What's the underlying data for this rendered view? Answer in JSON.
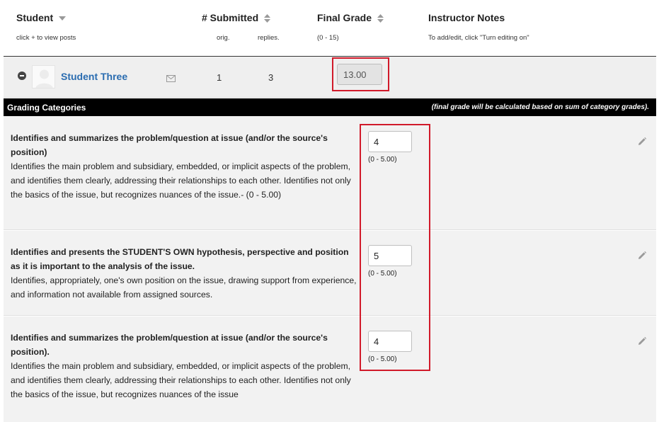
{
  "header": {
    "student": {
      "label": "Student",
      "sub": "click + to view posts"
    },
    "submitted": {
      "label": "# Submitted",
      "orig": "orig.",
      "replies": "replies."
    },
    "final_grade": {
      "label": "Final Grade",
      "sub": "(0 - 15)"
    },
    "notes": {
      "label": "Instructor Notes",
      "sub": "To add/edit, click \"Turn editing on\""
    }
  },
  "student": {
    "name": "Student Three",
    "orig": "1",
    "replies": "3",
    "final_grade": "13.00"
  },
  "band": {
    "title": "Grading Categories",
    "note": "(final grade will be calculated based on sum of category grades)."
  },
  "categories": [
    {
      "title": "Identifies and summarizes the problem/question at issue (and/or the source's position)",
      "desc": "Identifies the main problem and subsidiary, embedded, or implicit aspects of the problem, and identifies them clearly, addressing their relationships to each other. Identifies not only the basics of the issue, but recognizes nuances of the issue.- (0 - 5.00)",
      "score": "4",
      "range": "(0 - 5.00)"
    },
    {
      "title": "Identifies and presents the STUDENT'S OWN hypothesis, perspective and position as it is important to the analysis of the issue.",
      "desc": "Identifies, appropriately, one's own position on the issue, drawing support from experience, and information not available from assigned sources.",
      "score": "5",
      "range": "(0 - 5.00)"
    },
    {
      "title": "Identifies and summarizes the problem/question at issue (and/or the source's position).",
      "desc": "Identifies the main problem and subsidiary, embedded, or implicit aspects of the problem, and identifies them clearly, addressing their relationships to each other. Identifies not only the basics of the issue, but recognizes nuances of the issue",
      "score": "4",
      "range": "(0 - 5.00)"
    }
  ],
  "colors": {
    "link": "#2a6cb0",
    "highlight_box": "#d11a2a",
    "band": "#000000"
  },
  "icons": [
    "sort-icon",
    "collapse-icon",
    "avatar",
    "mail-icon",
    "pencil-icon"
  ]
}
